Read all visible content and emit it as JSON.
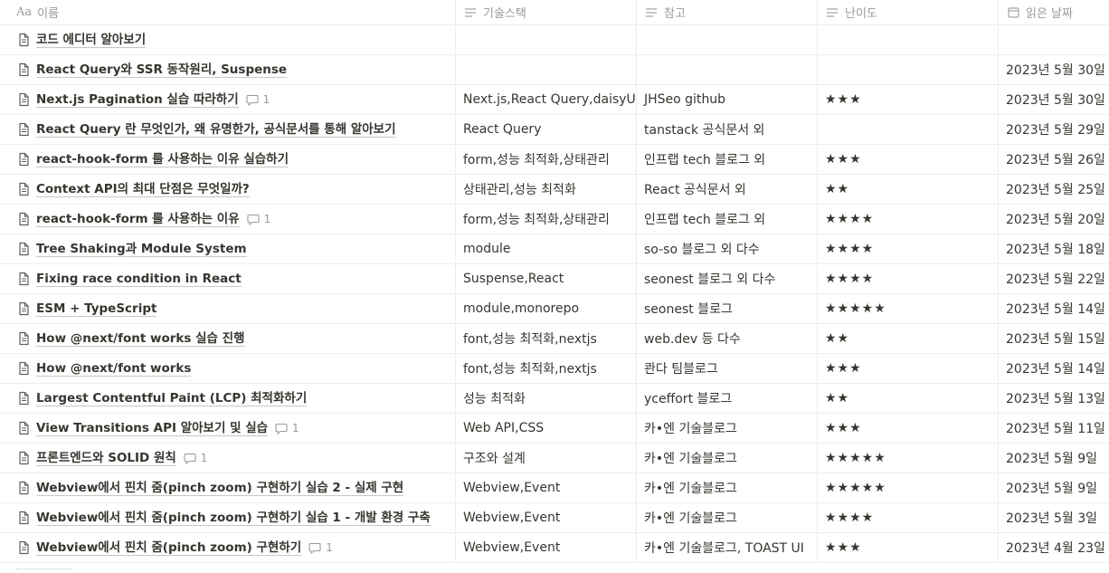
{
  "columns": {
    "name": "이름",
    "stack": "기술스택",
    "ref": "참고",
    "level": "난이도",
    "date": "읽은 날짜",
    "name_type_icon_text": "Aa"
  },
  "rows": [
    {
      "title": "코드 에디터 알아보기",
      "comments": "",
      "stack": "",
      "ref": "",
      "stars": "",
      "date": ""
    },
    {
      "title": "React Query와 SSR 동작원리, Suspense",
      "comments": "",
      "stack": "",
      "ref": "",
      "stars": "",
      "date": "2023년 5월 30일"
    },
    {
      "title": "Next.js Pagination 실습 따라하기",
      "comments": "1",
      "stack": "Next.js,React Query,daisyUI",
      "ref": "JHSeo github",
      "stars": "★★★",
      "date": "2023년 5월 30일"
    },
    {
      "title": "React Query 란 무엇인가, 왜 유명한가, 공식문서를 통해 알아보기",
      "comments": "",
      "stack": "React Query",
      "ref": "tanstack 공식문서 외",
      "stars": "",
      "date": "2023년 5월 29일"
    },
    {
      "title": "react-hook-form 를 사용하는 이유 실습하기",
      "comments": "",
      "stack": "form,성능 최적화,상태관리",
      "ref": "인프랩 tech 블로그 외",
      "stars": "★★★",
      "date": "2023년 5월 26일"
    },
    {
      "title": "Context API의 최대 단점은 무엇일까?",
      "comments": "",
      "stack": "상태관리,성능 최적화",
      "ref": "React 공식문서 외",
      "stars": "★★",
      "date": "2023년 5월 25일"
    },
    {
      "title": "react-hook-form 를 사용하는 이유",
      "comments": "1",
      "stack": "form,성능 최적화,상태관리",
      "ref": "인프랩 tech 블로그 외",
      "stars": "★★★★",
      "date": "2023년 5월 20일"
    },
    {
      "title": "Tree Shaking과 Module System",
      "comments": "",
      "stack": "module",
      "ref": "so-so 블로그 외 다수",
      "stars": "★★★★",
      "date": "2023년 5월 18일"
    },
    {
      "title": "Fixing race condition in React",
      "comments": "",
      "stack": "Suspense,React",
      "ref": "seonest 블로그 외 다수",
      "stars": "★★★★",
      "date": "2023년 5월 22일"
    },
    {
      "title": "ESM + TypeScript",
      "comments": "",
      "stack": "module,monorepo",
      "ref": "seonest 블로그",
      "stars": "★★★★★",
      "date": "2023년 5월 14일"
    },
    {
      "title": "How @next/font works 실습 진행",
      "comments": "",
      "stack": "font,성능 최적화,nextjs",
      "ref": "web.dev 등 다수",
      "stars": "★★",
      "date": "2023년 5월 15일"
    },
    {
      "title": "How @next/font works",
      "comments": "",
      "stack": "font,성능 최적화,nextjs",
      "ref": "콴다 팀블로그",
      "stars": "★★★",
      "date": "2023년 5월 14일"
    },
    {
      "title": "Largest Contentful Paint (LCP) 최적화하기",
      "comments": "",
      "stack": "성능 최적화",
      "ref": "yceffort 블로그",
      "stars": "★★",
      "date": "2023년 5월 13일"
    },
    {
      "title": "View Transitions API 알아보기 및 실습",
      "comments": "1",
      "stack": "Web API,CSS",
      "ref": "카•엔 기술블로그",
      "stars": "★★★",
      "date": "2023년 5월 11일"
    },
    {
      "title": "프론트엔드와 SOLID 원칙",
      "comments": "1",
      "stack": "구조와 설계",
      "ref": "카•엔 기술블로그",
      "stars": "★★★★★",
      "date": "2023년 5월 9일"
    },
    {
      "title": "Webview에서 핀치 줌(pinch zoom) 구현하기 실습 2 - 실제 구현",
      "comments": "",
      "stack": "Webview,Event",
      "ref": "카•엔 기술블로그",
      "stars": "★★★★★",
      "date": "2023년 5월 9일"
    },
    {
      "title": "Webview에서 핀치 줌(pinch zoom) 구현하기 실습 1 - 개발 환경 구축",
      "comments": "",
      "stack": "Webview,Event",
      "ref": "카•엔 기술블로그",
      "stars": "★★★★",
      "date": "2023년 5월 3일"
    },
    {
      "title": "Webview에서 핀치 줌(pinch zoom) 구현하기",
      "comments": "1",
      "stack": "Webview,Event",
      "ref": "카•엔 기술블로그, TOAST UI",
      "stars": "★★★",
      "date": "2023년 4월 23일"
    }
  ]
}
